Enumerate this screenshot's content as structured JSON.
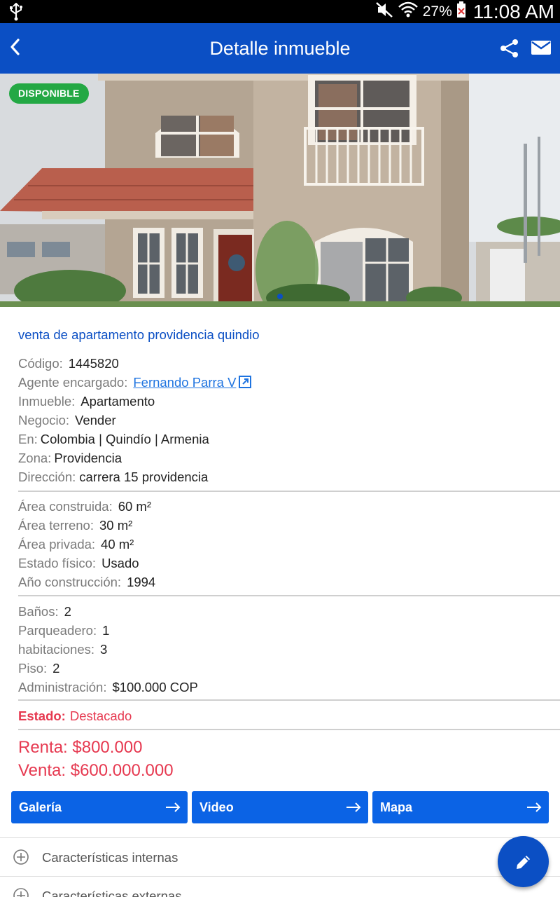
{
  "status_bar": {
    "battery_percent": "27%",
    "time": "11:08 AM"
  },
  "app_bar": {
    "title": "Detalle inmueble"
  },
  "hero": {
    "badge": "DISPONIBLE",
    "slide_index": 1
  },
  "listing": {
    "heading": "venta de apartamento providencia quindio",
    "group1": [
      {
        "label": "Código:",
        "value": "1445820"
      },
      {
        "label": "Agente encargado:",
        "value": "Fernando Parra V",
        "is_link": true
      },
      {
        "label": "Inmueble:",
        "value": "Apartamento"
      },
      {
        "label": "Negocio:",
        "value": "Vender"
      },
      {
        "label": "En:",
        "value": "Colombia | Quindío | Armenia"
      },
      {
        "label": "Zona:",
        "value": "Providencia"
      },
      {
        "label": "Dirección:",
        "value": "carrera 15 providencia"
      }
    ],
    "group2": [
      {
        "label": "Área construida:",
        "value": "60 m²"
      },
      {
        "label": "Área terreno:",
        "value": "30 m²"
      },
      {
        "label": "Área privada:",
        "value": "40 m²"
      },
      {
        "label": "Estado físico:",
        "value": "Usado"
      },
      {
        "label": "Año construcción:",
        "value": "1994"
      }
    ],
    "group3": [
      {
        "label": "Baños:",
        "value": "2"
      },
      {
        "label": "Parqueadero:",
        "value": "1"
      },
      {
        "label": "habitaciones:",
        "value": "3"
      },
      {
        "label": "Piso:",
        "value": "2"
      },
      {
        "label": "Administración:",
        "value": "$100.000 COP"
      }
    ],
    "estado": {
      "label": "Estado:",
      "value": "Destacado"
    },
    "prices": {
      "renta": "Renta: $800.000",
      "venta": "Venta: $600.000.000"
    }
  },
  "actions": [
    {
      "label": "Galería"
    },
    {
      "label": "Video"
    },
    {
      "label": "Mapa"
    }
  ],
  "sections": [
    {
      "label": "Características internas"
    },
    {
      "label": "Características externas"
    }
  ],
  "colors": {
    "app_bar": "#0b4fc4",
    "button": "#0b63e5",
    "badge": "#23a844",
    "accent_red": "#e63950",
    "link": "#1f74e0"
  }
}
